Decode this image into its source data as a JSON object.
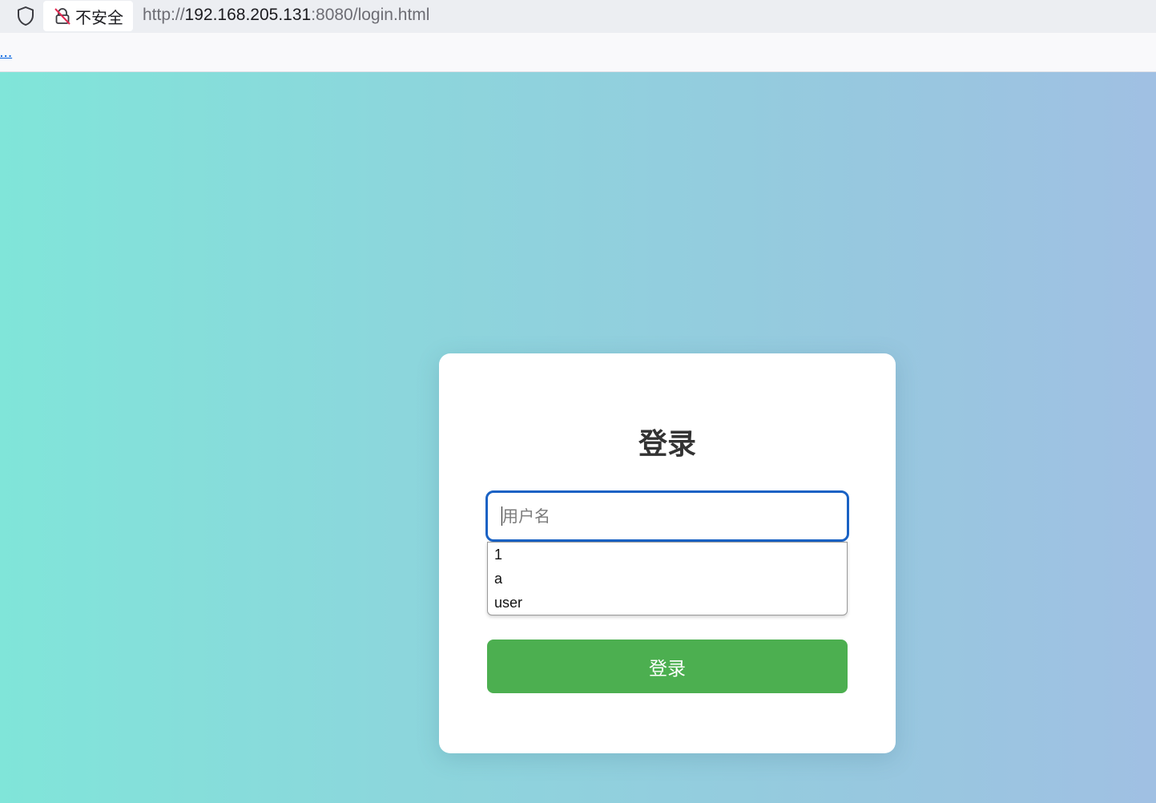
{
  "browser": {
    "security_label": "不安全",
    "url_scheme": "http://",
    "url_host": "192.168.205.131",
    "url_rest": ":8080/login.html",
    "bookmark_text": "...."
  },
  "login": {
    "title": "登录",
    "username_placeholder": "用户名",
    "username_value": "",
    "autocomplete_options": [
      "1",
      "a",
      "user"
    ],
    "submit_label": "登录"
  },
  "colors": {
    "focus_border": "#1a62c4",
    "button": "#4caf50",
    "gradient_start": "#80e5d9",
    "gradient_end": "#a0c0e3"
  },
  "icons": {
    "shield": "shield-icon",
    "insecure_lock": "insecure-lock-icon"
  }
}
